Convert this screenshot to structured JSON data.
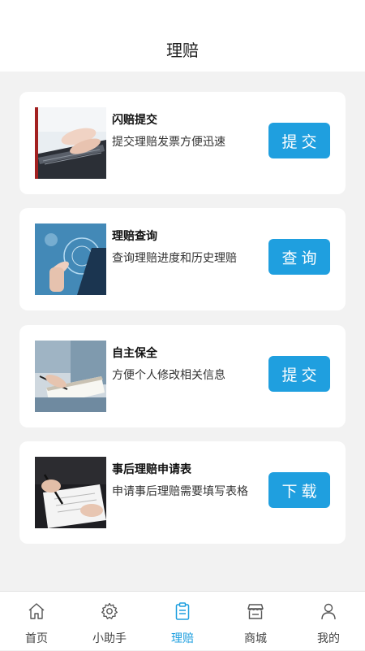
{
  "header": {
    "title": "理赔"
  },
  "cards": [
    {
      "name": "闪赔提交",
      "desc": "提交理赔发票方便迅速",
      "button": "提交",
      "image": "typing-laptop-photo"
    },
    {
      "name": "理赔查询",
      "desc": "查询理赔进度和历史理赔",
      "button": "查询",
      "image": "touchscreen-photo"
    },
    {
      "name": "自主保全",
      "desc": "方便个人修改相关信息",
      "button": "提交",
      "image": "writing-clipboard-photo"
    },
    {
      "name": "事后理赔申请表",
      "desc": "申请事后理赔需要填写表格",
      "button": "下载",
      "image": "signing-document-photo"
    }
  ],
  "tabbar": {
    "active_color": "#1f9fdf",
    "items": [
      {
        "label": "首页",
        "icon": "home-icon",
        "active": false
      },
      {
        "label": "小助手",
        "icon": "gear-icon",
        "active": false
      },
      {
        "label": "理赔",
        "icon": "clipboard-icon",
        "active": true
      },
      {
        "label": "商城",
        "icon": "store-icon",
        "active": false
      },
      {
        "label": "我的",
        "icon": "person-icon",
        "active": false
      }
    ]
  },
  "colors": {
    "accent": "#1f9fdf",
    "background": "#f2f2f2",
    "card": "#ffffff"
  }
}
